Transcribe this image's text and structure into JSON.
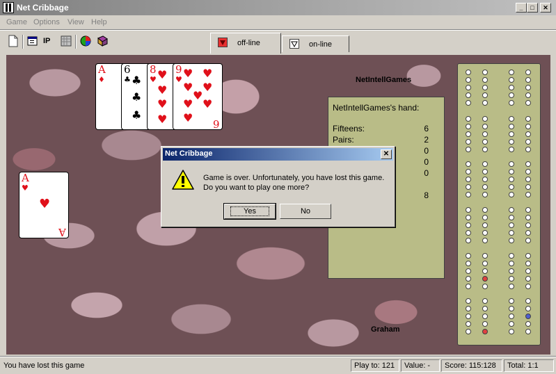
{
  "window": {
    "title": "Net Cribbage"
  },
  "menu": {
    "items": [
      "Game",
      "Options",
      "View",
      "Help"
    ]
  },
  "toolbar": {
    "ip_label": "IP",
    "tabs": [
      {
        "label": "off-line"
      },
      {
        "label": "on-line"
      }
    ]
  },
  "players": {
    "opponent_name": "NetIntellGames",
    "player_name": "Graham"
  },
  "hand_panel": {
    "title": "NetIntellGames's hand:",
    "rows": [
      {
        "label": "Fifteens:",
        "value": "6"
      },
      {
        "label": "Pairs:",
        "value": "2"
      },
      {
        "label": "",
        "value": "0"
      },
      {
        "label": "",
        "value": "0"
      },
      {
        "label": "",
        "value": "0"
      }
    ],
    "total": "8"
  },
  "cards": {
    "opponent": [
      {
        "rank": "A",
        "suit": "♦",
        "color": "red"
      },
      {
        "rank": "6",
        "suit": "♣",
        "color": "black"
      },
      {
        "rank": "8",
        "suit": "♥",
        "color": "red"
      },
      {
        "rank": "9",
        "suit": "♥",
        "color": "red"
      }
    ],
    "starter": {
      "rank": "A",
      "suit": "♥",
      "color": "red"
    }
  },
  "dialog": {
    "title": "Net Cribbage",
    "close": "✕",
    "line1": "Game is over. Unfortunately, you have lost this game.",
    "line2": "Do you want to play one more?",
    "yes_label": "Yes",
    "no_label": "No"
  },
  "status": {
    "message": "You have lost this game",
    "play_to": "Play to: 121",
    "value": "Value: -",
    "score": "Score: 115:128",
    "total": "Total: 1:1"
  },
  "colors": {
    "felt_panel": "#b9bc87",
    "red_peg": "#e04040",
    "blue_peg": "#5060d0",
    "dialog_title": "#0a246a"
  }
}
